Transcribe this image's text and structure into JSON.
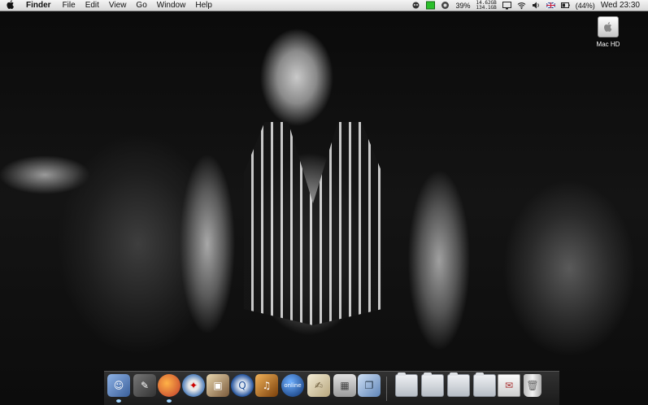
{
  "menubar": {
    "app_name": "Finder",
    "menus": [
      "File",
      "Edit",
      "View",
      "Go",
      "Window",
      "Help"
    ],
    "status": {
      "cpu_percent": "39%",
      "disk_top": "14.62GB",
      "disk_bottom": "134.1GB",
      "battery": "(44%)",
      "clock": "Wed 23:30"
    }
  },
  "desktop": {
    "icons": [
      {
        "label": "Mac HD",
        "icon": "hard-drive-icon"
      }
    ]
  },
  "dock": {
    "apps": [
      {
        "name": "finder-icon",
        "color": "#6a90c8"
      },
      {
        "name": "script-editor-icon",
        "color": "#b03030"
      },
      {
        "name": "firefox-icon",
        "color": "#d86a1a"
      },
      {
        "name": "safari-icon",
        "color": "#3a6fb3"
      },
      {
        "name": "iphoto-icon",
        "color": "#7a5a3a"
      },
      {
        "name": "quicktime-icon",
        "color": "#1f4f9a"
      },
      {
        "name": "garageband-icon",
        "color": "#c8781a"
      },
      {
        "name": "online-globe-icon",
        "color": "#1b5eb5"
      },
      {
        "name": "textedit-icon",
        "color": "#dcd3b8"
      },
      {
        "name": "calculator-icon",
        "color": "#b8b8b8"
      },
      {
        "name": "preview-icon",
        "color": "#5f85b8"
      }
    ],
    "online_label": "online",
    "folders": [
      {
        "name": "applications-folder-icon"
      },
      {
        "name": "documents-folder-icon"
      },
      {
        "name": "downloads-folder-icon"
      },
      {
        "name": "pictures-folder-icon"
      },
      {
        "name": "music-folder-icon"
      }
    ],
    "extras": [
      {
        "name": "mail-stack-icon"
      },
      {
        "name": "trash-icon"
      }
    ]
  },
  "colors": {
    "menubar_bg": "#e6e6e6",
    "dock_indicator": "#9fd3ff"
  }
}
